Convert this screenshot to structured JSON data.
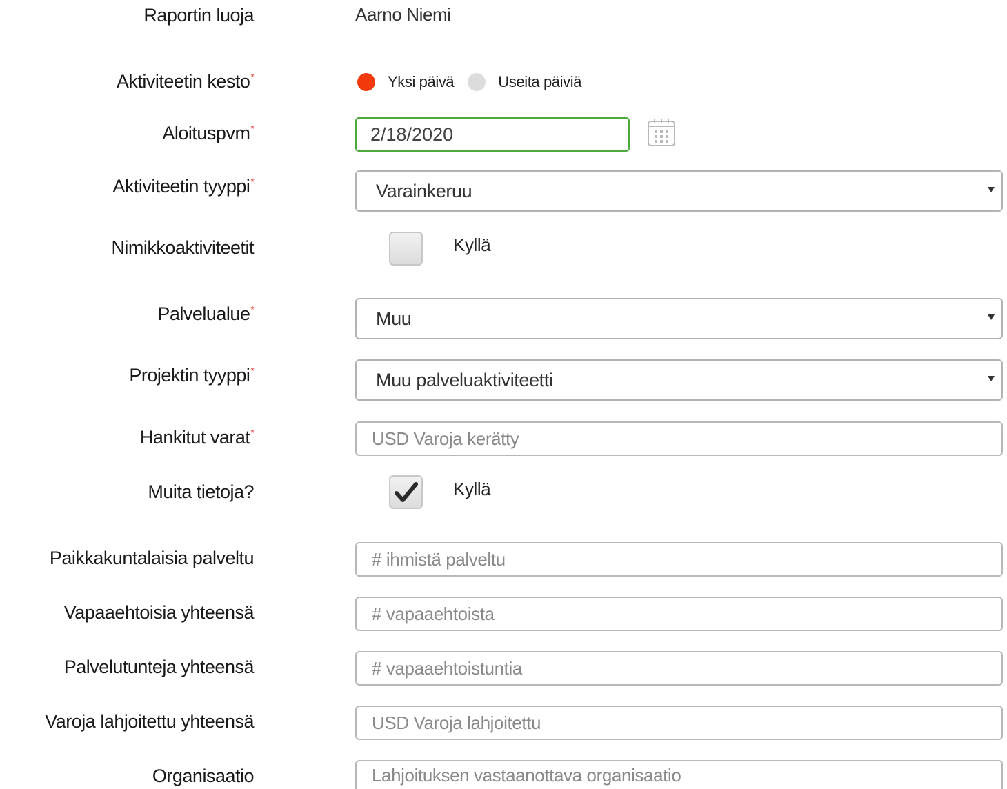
{
  "form": {
    "creator": {
      "label": "Raportin luoja",
      "value": "Aarno Niemi"
    },
    "duration": {
      "label": "Aktiviteetin kesto",
      "required": "*",
      "options": [
        {
          "label": "Yksi päivä",
          "selected": true
        },
        {
          "label": "Useita päiviä",
          "selected": false
        }
      ]
    },
    "start_date": {
      "label": "Aloituspvm",
      "required": "*",
      "value": "2/18/2020",
      "icon": "calendar-icon"
    },
    "activity_type": {
      "label": "Aktiviteetin tyyppi",
      "required": "*",
      "value": "Varainkeruu"
    },
    "title_activities": {
      "label": "Nimikkoaktiviteetit",
      "checkbox_label": "Kyllä",
      "checked": false
    },
    "service_area": {
      "label": "Palvelualue",
      "required": "*",
      "value": "Muu"
    },
    "project_type": {
      "label": "Projektin tyyppi",
      "required": "*",
      "value": "Muu palveluaktiviteetti"
    },
    "funds_raised": {
      "label": "Hankitut varat",
      "required": "*",
      "placeholder": "USD Varoja kerätty"
    },
    "more_info": {
      "label": "Muita tietoja?",
      "checkbox_label": "Kyllä",
      "checked": true
    },
    "people_served": {
      "label": "Paikkakuntalaisia palveltu",
      "placeholder": "# ihmistä palveltu"
    },
    "volunteers_total": {
      "label": "Vapaaehtoisia yhteensä",
      "placeholder": "# vapaaehtoista"
    },
    "service_hours_total": {
      "label": "Palvelutunteja yhteensä",
      "placeholder": "# vapaaehtoistuntia"
    },
    "funds_donated_total": {
      "label": "Varoja lahjoitettu yhteensä",
      "placeholder": "USD Varoja lahjoitettu"
    },
    "organization": {
      "label": "Organisaatio",
      "placeholder": "Lahjoituksen vastaanottava organisaatio"
    }
  },
  "colors": {
    "radio_selected": "#f23a0c",
    "radio_unselected": "#dcdcdc",
    "required_marker": "#e0231b",
    "date_field_border": "#4caa3a"
  }
}
